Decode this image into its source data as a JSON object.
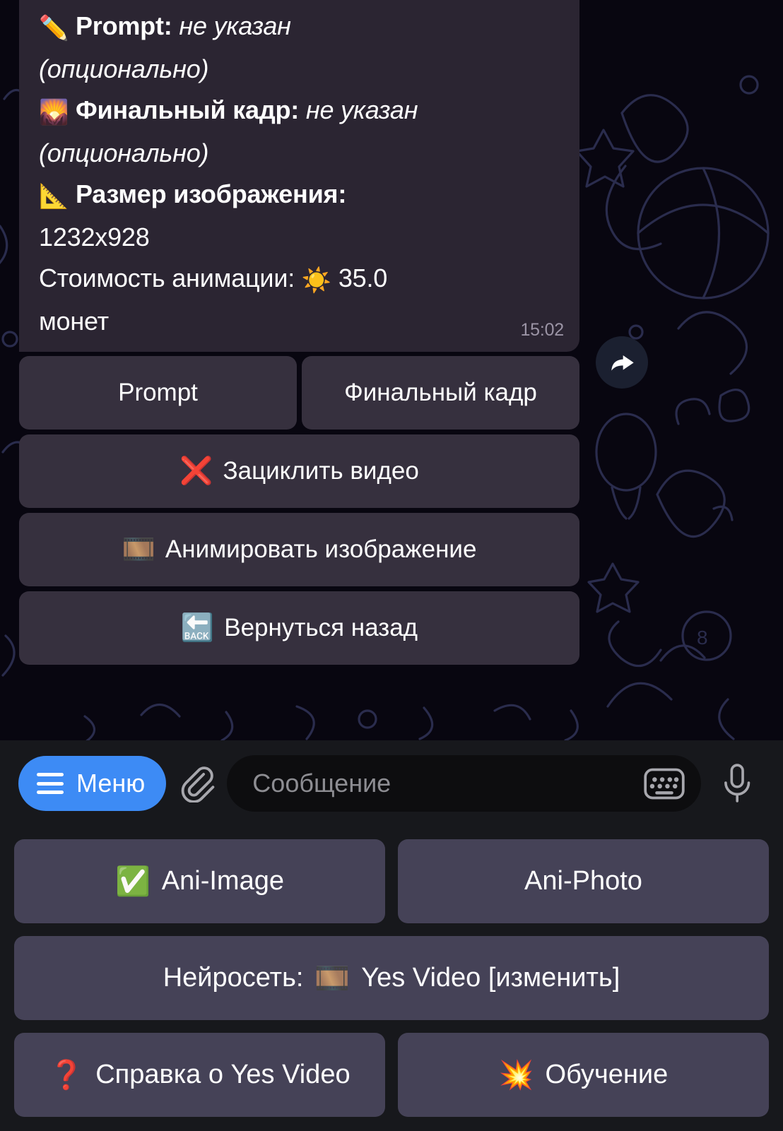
{
  "message": {
    "lines": [
      {
        "emoji": "✏️",
        "emoji_name": "pencil-icon",
        "label": "Prompt",
        "separator": ": ",
        "value": "не указан",
        "suffix": "(опционально)"
      },
      {
        "emoji": "🌄",
        "emoji_name": "sunrise-over-mountains-icon",
        "label": "Финальный кадр",
        "separator": ": ",
        "value": "не указан",
        "suffix": "(опционально)"
      },
      {
        "emoji": "📐",
        "emoji_name": "triangular-ruler-icon",
        "label": "Размер изображения",
        "separator": ":",
        "value": "1232x928",
        "suffix": ""
      }
    ],
    "cost_label": "Стоимость анимации:",
    "cost_emoji": "☀️",
    "cost_value": "35.0",
    "cost_unit": "монет",
    "timestamp": "15:02"
  },
  "inline_keyboard": [
    [
      {
        "label": "Prompt",
        "emoji": "",
        "name": "prompt"
      },
      {
        "label": "Финальный кадр",
        "emoji": "",
        "name": "final-frame"
      }
    ],
    [
      {
        "label": "Зациклить видео",
        "emoji": "❌",
        "name": "loop-video"
      }
    ],
    [
      {
        "label": "Анимировать изображение",
        "emoji": "🎞️",
        "name": "animate-image"
      }
    ],
    [
      {
        "label": "Вернуться назад",
        "emoji": "🔙",
        "name": "go-back"
      }
    ]
  ],
  "input_bar": {
    "menu_label": "Меню",
    "placeholder": "Сообщение",
    "value": ""
  },
  "reply_keyboard": [
    [
      {
        "label": "Ani-Image",
        "emoji": "✅",
        "name": "ani-image"
      },
      {
        "label": "Ani-Photo",
        "emoji": "",
        "name": "ani-photo"
      }
    ],
    [
      {
        "label_prefix": "Нейросеть:",
        "emoji": "🎞️",
        "label": "Yes Video [изменить]",
        "name": "neural-network"
      }
    ],
    [
      {
        "label": "Справка о Yes Video",
        "emoji": "❓",
        "name": "help-yes-video"
      },
      {
        "label": "Обучение",
        "emoji": "💥",
        "name": "training"
      }
    ]
  ],
  "colors": {
    "accent_blue": "#3d8bf5",
    "bubble": "#2b2532",
    "inline_button": "#36303e",
    "reply_button": "#454257",
    "input_bg": "#17181c",
    "wallpaper": "#080610"
  }
}
